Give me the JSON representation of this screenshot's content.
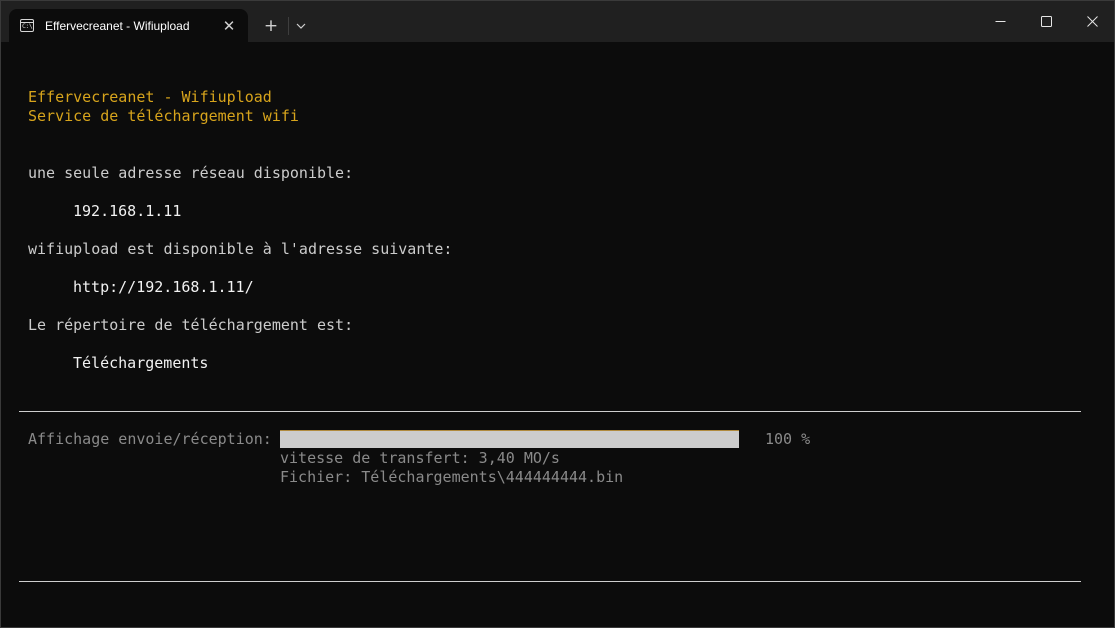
{
  "window": {
    "tab_title": "Effervecreanet - Wifiupload",
    "tab_icon": "terminal-icon",
    "tab_icon_glyph": "C:\\",
    "controls": {
      "new_tab": "+",
      "close_tab": "✕"
    }
  },
  "colors": {
    "background": "#0c0c0c",
    "titlebar": "#202020",
    "accent_yellow": "#d7a41c",
    "text": "#cccccc",
    "muted_text": "#8a8a8a"
  },
  "header": {
    "title": "Effervecreanet - Wifiupload",
    "subtitle": "Service de téléchargement wifi"
  },
  "network": {
    "label": "une seule adresse réseau disponible:",
    "address": "192.168.1.11"
  },
  "url": {
    "label": "wifiupload est disponible à l'adresse suivante:",
    "value": "http://192.168.1.11/"
  },
  "directory": {
    "label": "Le répertoire de téléchargement est:",
    "value": "Téléchargements"
  },
  "transfer": {
    "label": "Affichage envoie/réception:",
    "progress_percent": 100,
    "progress_text": "100 %",
    "speed": "vitesse de transfert: 3,40 MO/s",
    "file": "Fichier: Téléchargements\\444444444.bin"
  }
}
